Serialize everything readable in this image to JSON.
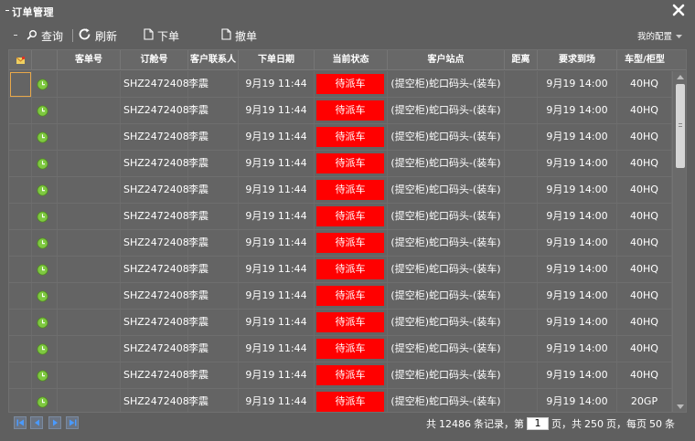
{
  "window": {
    "title": "订单管理"
  },
  "toolbar": {
    "query_label": "查询",
    "refresh_label": "刷新",
    "order_label": "下单",
    "cancel_label": "撤单",
    "config_label": "我的配置"
  },
  "columns": {
    "customer_no": "客单号",
    "order_no": "订舱号",
    "contact": "客户联系人",
    "order_date": "下单日期",
    "status": "当前状态",
    "site": "客户站点",
    "distance": "距离",
    "arrival": "要求到场",
    "vehicle": "车型/柜型"
  },
  "rows": [
    {
      "order_no": "SHZ2472408",
      "contact": "李震",
      "order_date": "9月19 11:44",
      "status": "待派车",
      "site": "(提空柜)蛇口码头-(装车)",
      "distance": "",
      "arrival": "9月19 14:00",
      "vehicle": "40HQ"
    },
    {
      "order_no": "SHZ2472408",
      "contact": "李震",
      "order_date": "9月19 11:44",
      "status": "待派车",
      "site": "(提空柜)蛇口码头-(装车)",
      "distance": "",
      "arrival": "9月19 14:00",
      "vehicle": "40HQ"
    },
    {
      "order_no": "SHZ2472408",
      "contact": "李震",
      "order_date": "9月19 11:44",
      "status": "待派车",
      "site": "(提空柜)蛇口码头-(装车)",
      "distance": "",
      "arrival": "9月19 14:00",
      "vehicle": "40HQ"
    },
    {
      "order_no": "SHZ2472408",
      "contact": "李震",
      "order_date": "9月19 11:44",
      "status": "待派车",
      "site": "(提空柜)蛇口码头-(装车)",
      "distance": "",
      "arrival": "9月19 14:00",
      "vehicle": "40HQ"
    },
    {
      "order_no": "SHZ2472408",
      "contact": "李震",
      "order_date": "9月19 11:44",
      "status": "待派车",
      "site": "(提空柜)蛇口码头-(装车)",
      "distance": "",
      "arrival": "9月19 14:00",
      "vehicle": "40HQ"
    },
    {
      "order_no": "SHZ2472408",
      "contact": "李震",
      "order_date": "9月19 11:44",
      "status": "待派车",
      "site": "(提空柜)蛇口码头-(装车)",
      "distance": "",
      "arrival": "9月19 14:00",
      "vehicle": "40HQ"
    },
    {
      "order_no": "SHZ2472408",
      "contact": "李震",
      "order_date": "9月19 11:44",
      "status": "待派车",
      "site": "(提空柜)蛇口码头-(装车)",
      "distance": "",
      "arrival": "9月19 14:00",
      "vehicle": "40HQ"
    },
    {
      "order_no": "SHZ2472408",
      "contact": "李震",
      "order_date": "9月19 11:44",
      "status": "待派车",
      "site": "(提空柜)蛇口码头-(装车)",
      "distance": "",
      "arrival": "9月19 14:00",
      "vehicle": "40HQ"
    },
    {
      "order_no": "SHZ2472408",
      "contact": "李震",
      "order_date": "9月19 11:44",
      "status": "待派车",
      "site": "(提空柜)蛇口码头-(装车)",
      "distance": "",
      "arrival": "9月19 14:00",
      "vehicle": "40HQ"
    },
    {
      "order_no": "SHZ2472408",
      "contact": "李震",
      "order_date": "9月19 11:44",
      "status": "待派车",
      "site": "(提空柜)蛇口码头-(装车)",
      "distance": "",
      "arrival": "9月19 14:00",
      "vehicle": "40HQ"
    },
    {
      "order_no": "SHZ2472408",
      "contact": "李震",
      "order_date": "9月19 11:44",
      "status": "待派车",
      "site": "(提空柜)蛇口码头-(装车)",
      "distance": "",
      "arrival": "9月19 14:00",
      "vehicle": "40HQ"
    },
    {
      "order_no": "SHZ2472408",
      "contact": "李震",
      "order_date": "9月19 11:44",
      "status": "待派车",
      "site": "(提空柜)蛇口码头-(装车)",
      "distance": "",
      "arrival": "9月19 14:00",
      "vehicle": "40HQ"
    },
    {
      "order_no": "SHZ2472408",
      "contact": "李震",
      "order_date": "9月19 11:44",
      "status": "待派车",
      "site": "(提空柜)蛇口码头-(装车)",
      "distance": "",
      "arrival": "9月19 14:00",
      "vehicle": "20GP"
    }
  ],
  "pagination": {
    "total_prefix": "共",
    "total_records": "12486",
    "records_suffix": "条记录，第",
    "current_page": "1",
    "page_of": "页，共",
    "total_pages": "250",
    "per_page_prefix": "页，每页",
    "per_page": "50",
    "per_page_suffix": "条"
  },
  "colors": {
    "background": "#5f5f5f",
    "status_red": "#ff0000",
    "clock_green": "#7ec840",
    "selection_orange": "#e8a84a"
  },
  "icons": {
    "close": "close-icon",
    "query": "search-icon",
    "refresh": "refresh-icon",
    "order": "document-icon",
    "cancel": "document-icon",
    "header": "flag-icon",
    "row": "clock-icon"
  }
}
